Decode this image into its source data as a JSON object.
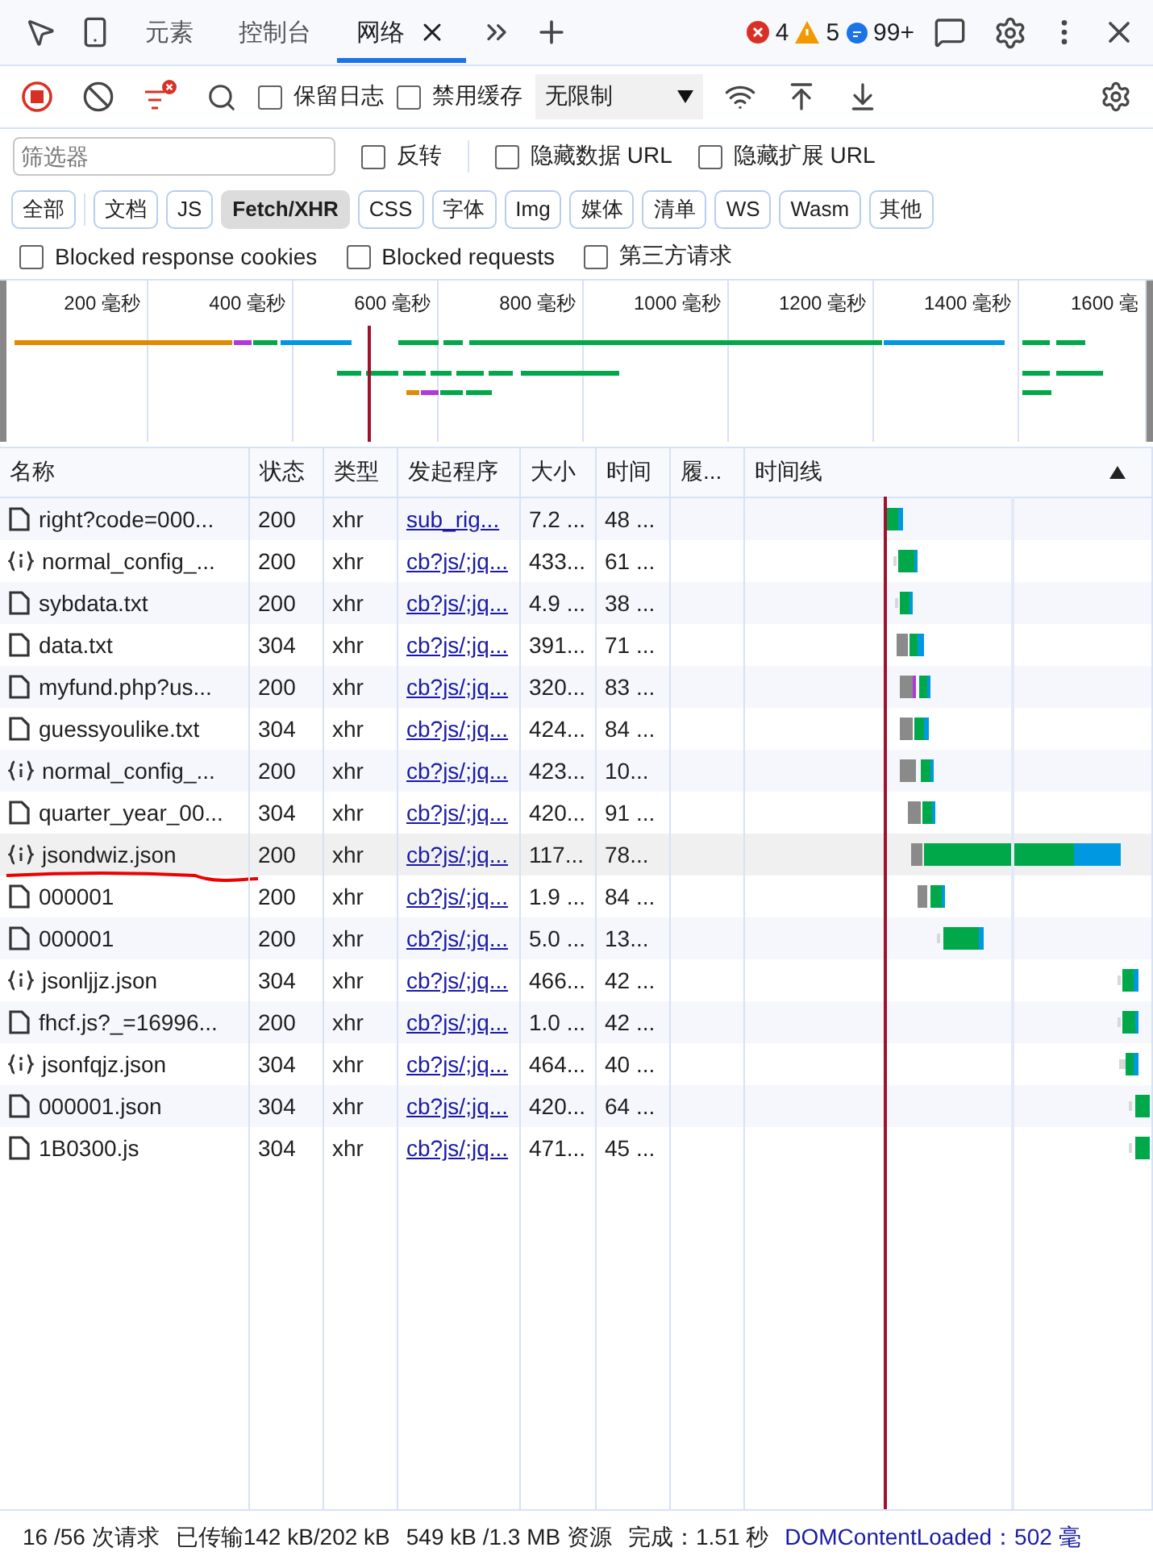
{
  "tabbar": {
    "tabs": [
      {
        "label": "元素",
        "selected": false
      },
      {
        "label": "控制台",
        "selected": false
      },
      {
        "label": "网络",
        "selected": true
      }
    ],
    "errors": "4",
    "warnings": "5",
    "messages": "99+"
  },
  "toolbar": {
    "recording": true,
    "preserve_log": {
      "label": "保留日志",
      "checked": false
    },
    "disable_cache": {
      "label": "禁用缓存",
      "checked": false
    },
    "throttling": "无限制"
  },
  "filter": {
    "placeholder": "筛选器",
    "options": [
      {
        "label": "反转",
        "checked": false
      },
      {
        "label": "隐藏数据 URL",
        "checked": false
      },
      {
        "label": "隐藏扩展 URL",
        "checked": false
      }
    ]
  },
  "types": [
    {
      "label": "全部",
      "selected": false
    },
    {
      "label": "文档",
      "selected": false
    },
    {
      "label": "JS",
      "selected": false
    },
    {
      "label": "Fetch/XHR",
      "selected": true
    },
    {
      "label": "CSS",
      "selected": false
    },
    {
      "label": "字体",
      "selected": false
    },
    {
      "label": "Img",
      "selected": false
    },
    {
      "label": "媒体",
      "selected": false
    },
    {
      "label": "清单",
      "selected": false
    },
    {
      "label": "WS",
      "selected": false
    },
    {
      "label": "Wasm",
      "selected": false
    },
    {
      "label": "其他",
      "selected": false
    }
  ],
  "blocked_options": [
    {
      "label": "Blocked response cookies",
      "checked": false
    },
    {
      "label": "Blocked requests",
      "checked": false
    },
    {
      "label": "第三方请求",
      "checked": false
    }
  ],
  "overview": {
    "ticks": [
      "200 毫秒",
      "400 毫秒",
      "600 毫秒",
      "800 毫秒",
      "1000 毫秒",
      "1200 毫秒",
      "1400 毫秒",
      "1600 毫"
    ]
  },
  "table": {
    "columns": [
      "名称",
      "状态",
      "类型",
      "发起程序",
      "大小",
      "时间",
      "履...",
      "时间线"
    ],
    "sort_ascending": true,
    "rows": [
      {
        "kind": "document",
        "name": "right?code=000...",
        "status": "200",
        "type": "xhr",
        "initiator": "sub_rig...",
        "size": "7.2 ...",
        "time": "48 ...",
        "selected": false,
        "underlined": false
      },
      {
        "kind": "json",
        "name": "normal_config_...",
        "status": "200",
        "type": "xhr",
        "initiator": "cb?js/;jq...",
        "size": "433...",
        "time": "61 ...",
        "selected": false,
        "underlined": false
      },
      {
        "kind": "document",
        "name": "sybdata.txt",
        "status": "200",
        "type": "xhr",
        "initiator": "cb?js/;jq...",
        "size": "4.9 ...",
        "time": "38 ...",
        "selected": false,
        "underlined": false
      },
      {
        "kind": "document",
        "name": "data.txt",
        "status": "304",
        "type": "xhr",
        "initiator": "cb?js/;jq...",
        "size": "391...",
        "time": "71 ...",
        "selected": false,
        "underlined": false
      },
      {
        "kind": "document",
        "name": "myfund.php?us...",
        "status": "200",
        "type": "xhr",
        "initiator": "cb?js/;jq...",
        "size": "320...",
        "time": "83 ...",
        "selected": false,
        "underlined": false
      },
      {
        "kind": "document",
        "name": "guessyoulike.txt",
        "status": "304",
        "type": "xhr",
        "initiator": "cb?js/;jq...",
        "size": "424...",
        "time": "84 ...",
        "selected": false,
        "underlined": false
      },
      {
        "kind": "json",
        "name": "normal_config_...",
        "status": "200",
        "type": "xhr",
        "initiator": "cb?js/;jq...",
        "size": "423...",
        "time": "10...",
        "selected": false,
        "underlined": false
      },
      {
        "kind": "document",
        "name": "quarter_year_00...",
        "status": "304",
        "type": "xhr",
        "initiator": "cb?js/;jq...",
        "size": "420...",
        "time": "91 ...",
        "selected": false,
        "underlined": false
      },
      {
        "kind": "json",
        "name": "jsondwiz.json",
        "status": "200",
        "type": "xhr",
        "initiator": "cb?js/;jq...",
        "size": "117...",
        "time": "78...",
        "selected": true,
        "underlined": true
      },
      {
        "kind": "document",
        "name": "000001",
        "status": "200",
        "type": "xhr",
        "initiator": "cb?js/;jq...",
        "size": "1.9 ...",
        "time": "84 ...",
        "selected": false,
        "underlined": false
      },
      {
        "kind": "document",
        "name": "000001",
        "status": "200",
        "type": "xhr",
        "initiator": "cb?js/;jq...",
        "size": "5.0 ...",
        "time": "13...",
        "selected": false,
        "underlined": false
      },
      {
        "kind": "json",
        "name": "jsonljjz.json",
        "status": "304",
        "type": "xhr",
        "initiator": "cb?js/;jq...",
        "size": "466...",
        "time": "42 ...",
        "selected": false,
        "underlined": false
      },
      {
        "kind": "document",
        "name": "fhcf.js?_=16996...",
        "status": "200",
        "type": "xhr",
        "initiator": "cb?js/;jq...",
        "size": "1.0 ...",
        "time": "42 ...",
        "selected": false,
        "underlined": false
      },
      {
        "kind": "json",
        "name": "jsonfqjz.json",
        "status": "304",
        "type": "xhr",
        "initiator": "cb?js/;jq...",
        "size": "464...",
        "time": "40 ...",
        "selected": false,
        "underlined": false
      },
      {
        "kind": "document",
        "name": "000001.json",
        "status": "304",
        "type": "xhr",
        "initiator": "cb?js/;jq...",
        "size": "420...",
        "time": "64 ...",
        "selected": false,
        "underlined": false
      },
      {
        "kind": "document",
        "name": "1B0300.js",
        "status": "304",
        "type": "xhr",
        "initiator": "cb?js/;jq...",
        "size": "471...",
        "time": "45 ...",
        "selected": false,
        "underlined": false
      }
    ]
  },
  "status_bar": {
    "requests": "16 /56 次请求",
    "transferred": "已传输142 kB/202 kB",
    "resources": "549 kB /1.3 MB 资源",
    "finish": "完成：1.51 秒",
    "dom_content_loaded": "DOMContentLoaded：502 毫"
  }
}
